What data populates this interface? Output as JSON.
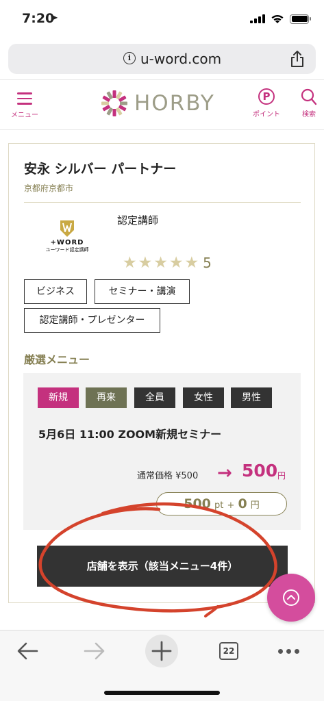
{
  "status_bar": {
    "time": "7:20",
    "location_icon": "location-arrow-icon"
  },
  "browser": {
    "url": "u-word.com",
    "tab_count": "22"
  },
  "site_header": {
    "menu_label": "メニュー",
    "logo_text": "HORBY",
    "point_letter": "P",
    "point_label": "ポイント",
    "search_label": "検索"
  },
  "shop": {
    "name": "安永 シルバー パートナー",
    "location": "京都府京都市",
    "thumb_word": "+WORD",
    "thumb_sub": "ユーワード認定講師",
    "certification": "認定講師",
    "rating": "5",
    "stars": 5,
    "tags": [
      "ビジネス",
      "セミナー・講演",
      "認定講師・プレゼンター"
    ]
  },
  "featured_menu": {
    "section_title": "厳選メニュー",
    "badges": [
      {
        "label": "新規",
        "color": "#c4317e"
      },
      {
        "label": "再来",
        "color": "#6e7254"
      },
      {
        "label": "全員",
        "color": "#333333"
      },
      {
        "label": "女性",
        "color": "#333333"
      },
      {
        "label": "男性",
        "color": "#333333"
      }
    ],
    "title": "5月6日 11:00 ZOOM新規セミナー",
    "normal_price": "通常価格 ¥500",
    "arrow": "→",
    "sale_price": "500",
    "sale_unit": "円",
    "points_value": "500",
    "points_unit": "pt",
    "points_plus": "+",
    "cash_value": "0",
    "cash_unit": "円"
  },
  "show_shop_button": "店舗を表示（該当メニュー4件）",
  "colors": {
    "accent": "#c4317e",
    "olive": "#857f52",
    "dark": "#333333",
    "annotation": "#d4432c"
  }
}
